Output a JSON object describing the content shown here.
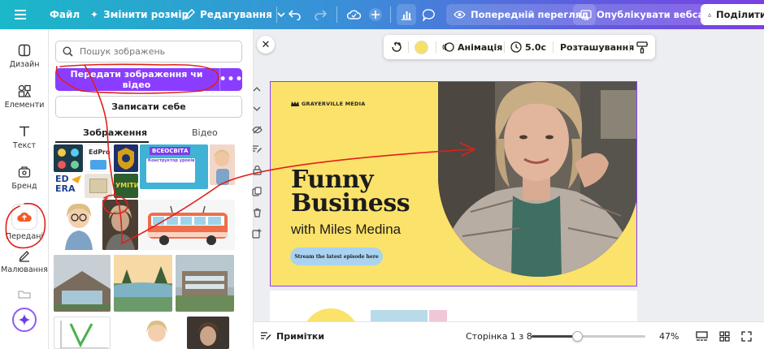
{
  "topbar": {
    "menu_icon": "hamburger-icon",
    "file": "Файл",
    "resize": "Змінити розмір",
    "edit": "Редагування",
    "preview": "Попередній перегляд",
    "publish": "Опублікувати вебсайт",
    "share": "Поділити"
  },
  "rail": {
    "items": [
      {
        "label": "Дизайн",
        "icon": "design-icon"
      },
      {
        "label": "Елементи",
        "icon": "elements-icon"
      },
      {
        "label": "Текст",
        "icon": "text-icon"
      },
      {
        "label": "Бренд",
        "icon": "brand-icon"
      },
      {
        "label": "Передані",
        "icon": "upload-cloud-icon"
      },
      {
        "label": "Малювання",
        "icon": "draw-icon"
      }
    ],
    "active": "Передані"
  },
  "panel": {
    "search_placeholder": "Пошук зображень",
    "upload_button": "Передати зображення чи відео",
    "more": "•••",
    "record_button": "Записати себе",
    "tabs": [
      "Зображення",
      "Відео"
    ],
    "active_tab": "Зображення",
    "thumb_labels": {
      "edpro": "EdPro",
      "vsesvita": "ВСЕОСВІТА",
      "konstruktor": "Конструктор уроків",
      "edera": "ED ERA",
      "umity": "УМІТИ"
    }
  },
  "context_toolbar": {
    "animation": "Анімація",
    "duration": "5.0с",
    "position": "Розташування",
    "accent_color": "#f7e06a"
  },
  "design": {
    "brand": "GRAYERVILLE MEDIA",
    "headline_line1": "Funny",
    "headline_line2": "Business",
    "subtitle": "with Miles Medina",
    "cta": "Stream the latest episode here",
    "background_color": "#fbe26a"
  },
  "bottombar": {
    "notes": "Примітки",
    "page_indicator": "Сторінка 1 з 8",
    "zoom": "47%",
    "zoom_fraction": 0.4
  },
  "colors": {
    "accent": "#8b3dff",
    "annotation": "#e0201b"
  }
}
